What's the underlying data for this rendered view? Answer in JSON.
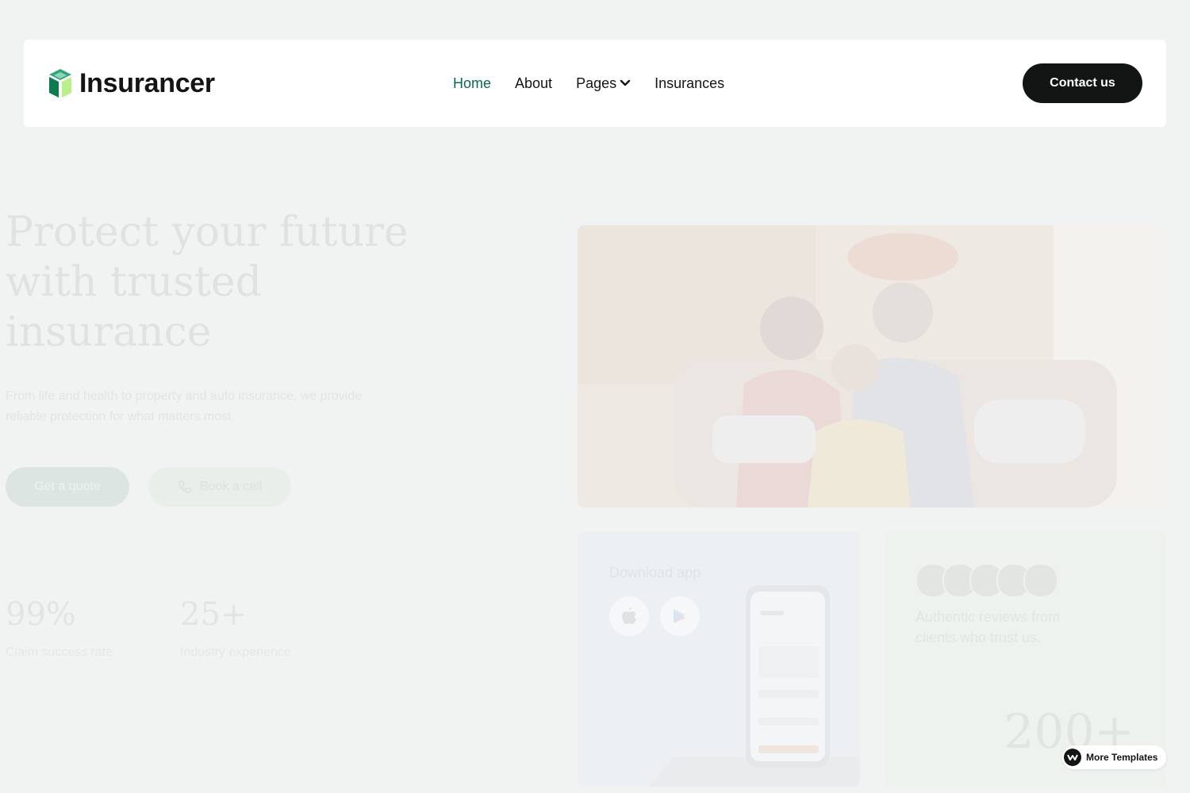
{
  "header": {
    "logo_text": "Insurancer",
    "nav": [
      {
        "label": "Home",
        "active": true
      },
      {
        "label": "About"
      },
      {
        "label": "Pages",
        "has_dropdown": true
      },
      {
        "label": "Insurances"
      }
    ],
    "contact_label": "Contact us"
  },
  "hero": {
    "title": "Protect your future with trusted insurance",
    "subtitle": "From life and health to property and auto insurance, we provide reliable protection for what matters most.",
    "primary_button": "Get a quote",
    "secondary_button": "Book a call",
    "stats": [
      {
        "value": "99%",
        "label": "Claim success rate"
      },
      {
        "value": "25+",
        "label": "Industry experience"
      }
    ]
  },
  "cards": {
    "app_title": "Download app",
    "reviews_text": "Authentic reviews from clients who trust us.",
    "reviews_count": "200+"
  },
  "badge": {
    "label": "More Templates"
  },
  "colors": {
    "accent": "#0c6a4a",
    "dark": "#121514",
    "background": "#f1f3f2",
    "logo_green": "#2e8b57"
  }
}
